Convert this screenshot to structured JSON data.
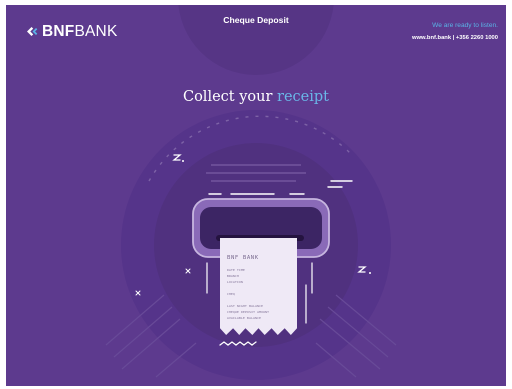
{
  "header": {
    "logo": {
      "bold": "BNF",
      "light": "BANK"
    },
    "title": "Cheque Deposit",
    "tagline": "We are ready to listen.",
    "contact": "www.bnf.bank | +356 2260 1000"
  },
  "main": {
    "heading": {
      "part1": "Collect your",
      "part2": "receipt"
    }
  },
  "receipt": {
    "bank": "BNF BANK",
    "lines": [
      "DATE TIME",
      "BRANCH",
      "LOCATION",
      "CHEQ",
      "LAST NIGHT BALANCE",
      "CHEQUE DEPOSIT AMOUNT",
      "AVAILABLE BALANCE"
    ]
  },
  "colors": {
    "background": "#5d3a8e",
    "accent": "#6ab7e8",
    "tagline": "#5ab3e6"
  }
}
